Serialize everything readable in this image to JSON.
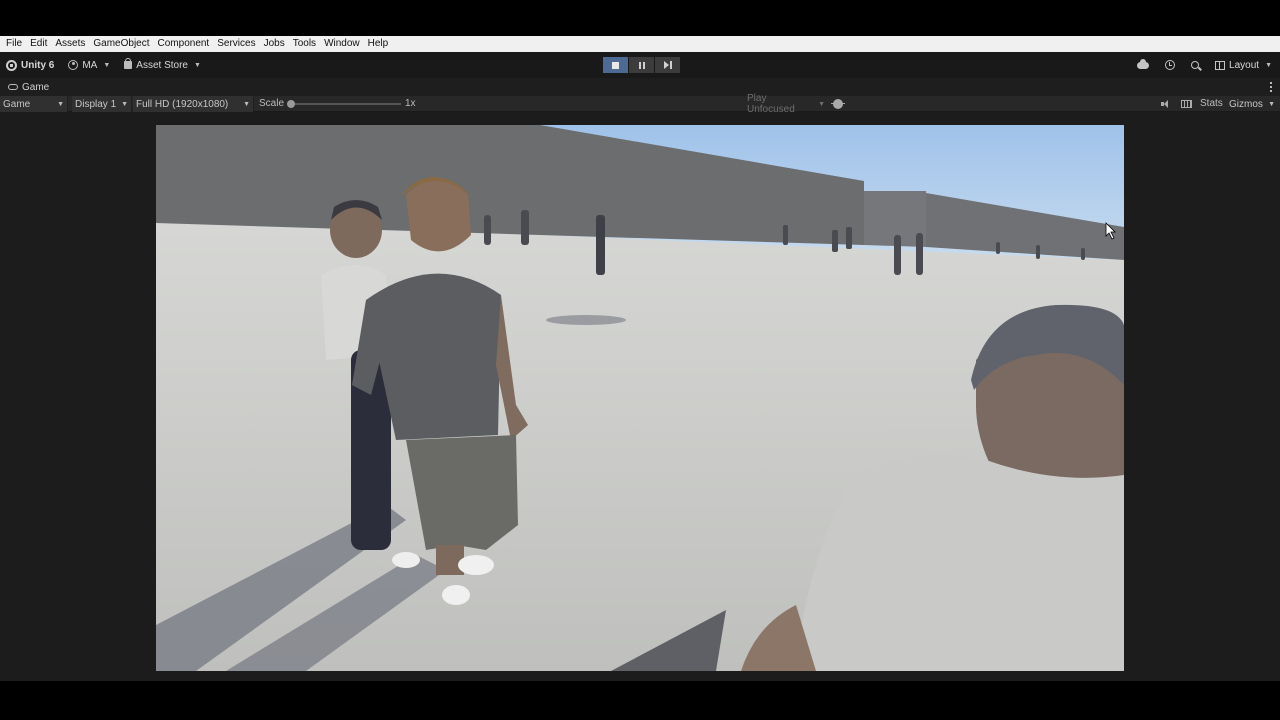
{
  "menu": [
    "File",
    "Edit",
    "Assets",
    "GameObject",
    "Component",
    "Services",
    "Jobs",
    "Tools",
    "Window",
    "Help"
  ],
  "toolbar": {
    "product": "Unity 6",
    "account": "MA",
    "asset_store": "Asset Store",
    "layout": "Layout"
  },
  "tab": {
    "label": "Game"
  },
  "game_toolbar": {
    "view_mode": "Game",
    "display": "Display 1",
    "resolution": "Full HD (1920x1080)",
    "scale_label": "Scale",
    "scale_value": "1x",
    "play_mode": "Play Unfocused",
    "stats": "Stats",
    "gizmos": "Gizmos"
  },
  "colors": {
    "play_active": "#4c6a93",
    "editor_bg": "#1c1c1c",
    "sky": "#a7c8ec",
    "ground": "#cfd0cd",
    "wall": "#6f7071"
  }
}
